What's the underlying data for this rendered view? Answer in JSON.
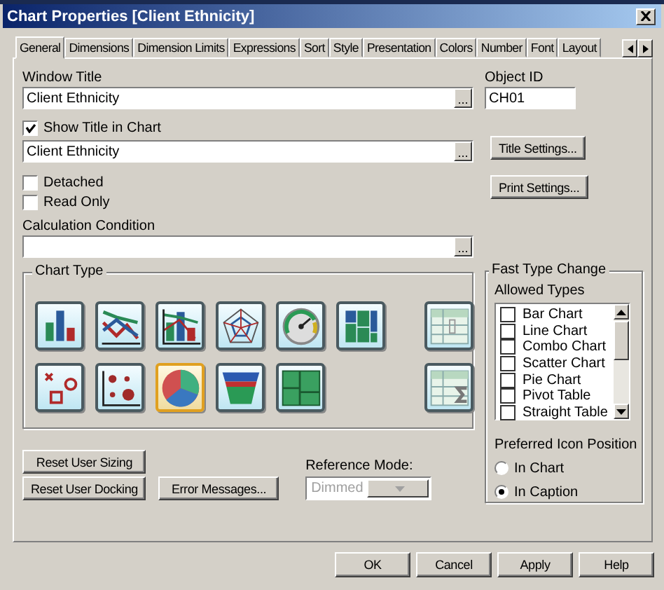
{
  "window": {
    "title": "Chart Properties [Client Ethnicity]"
  },
  "tabs": [
    {
      "label": "General",
      "selected": true
    },
    {
      "label": "Dimensions",
      "selected": false
    },
    {
      "label": "Dimension Limits",
      "selected": false
    },
    {
      "label": "Expressions",
      "selected": false
    },
    {
      "label": "Sort",
      "selected": false
    },
    {
      "label": "Style",
      "selected": false
    },
    {
      "label": "Presentation",
      "selected": false
    },
    {
      "label": "Colors",
      "selected": false
    },
    {
      "label": "Number",
      "selected": false
    },
    {
      "label": "Font",
      "selected": false
    },
    {
      "label": "Layout",
      "selected": false
    }
  ],
  "window_title": {
    "label": "Window Title",
    "value": "Client Ethnicity",
    "browse_button": "..."
  },
  "object_id": {
    "label": "Object ID",
    "value": "CH01"
  },
  "show_title": {
    "label": "Show Title in Chart",
    "checked": true,
    "value": "Client Ethnicity",
    "browse_button": "..."
  },
  "title_settings_button": "Title Settings...",
  "print_settings_button": "Print Settings...",
  "options": [
    {
      "label": "Detached",
      "checked": false
    },
    {
      "label": "Read Only",
      "checked": false
    }
  ],
  "calculation_condition": {
    "label": "Calculation Condition",
    "browse_button": "..."
  },
  "chart_type": {
    "title": "Chart Type",
    "types": [
      {
        "kind": "bar",
        "selected": false
      },
      {
        "kind": "line",
        "selected": false
      },
      {
        "kind": "combo",
        "selected": false
      },
      {
        "kind": "radar",
        "selected": false
      },
      {
        "kind": "gauge",
        "selected": false
      },
      {
        "kind": "mekko",
        "selected": false
      },
      {
        "kind": "pivot",
        "selected": false
      },
      {
        "kind": "scatter",
        "selected": false
      },
      {
        "kind": "grid",
        "selected": false
      },
      {
        "kind": "pie",
        "selected": true
      },
      {
        "kind": "funnel",
        "selected": false
      },
      {
        "kind": "block",
        "selected": false
      },
      {
        "kind": "straight",
        "selected": false
      }
    ]
  },
  "fast_type_change": {
    "title": "Fast Type Change",
    "allowed_label": "Allowed Types",
    "items": [
      {
        "label": "Bar Chart",
        "checked": false
      },
      {
        "label": "Line Chart",
        "checked": false
      },
      {
        "label": "Combo Chart",
        "checked": false
      },
      {
        "label": "Scatter Chart",
        "checked": false
      },
      {
        "label": "Pie Chart",
        "checked": false
      },
      {
        "label": "Pivot Table",
        "checked": false
      },
      {
        "label": "Straight Table",
        "checked": false
      }
    ],
    "icon_position": {
      "label": "Preferred Icon Position",
      "options": [
        {
          "label": "In Chart",
          "selected": false
        },
        {
          "label": "In Caption",
          "selected": true
        }
      ]
    }
  },
  "reset_buttons": [
    "Reset User Sizing",
    "Reset User Docking"
  ],
  "error_messages_button": "Error Messages...",
  "reference_mode": {
    "label": "Reference Mode:",
    "value": "Dimmed",
    "disabled": true
  },
  "footer_buttons": [
    "OK",
    "Cancel",
    "Apply",
    "Help"
  ]
}
